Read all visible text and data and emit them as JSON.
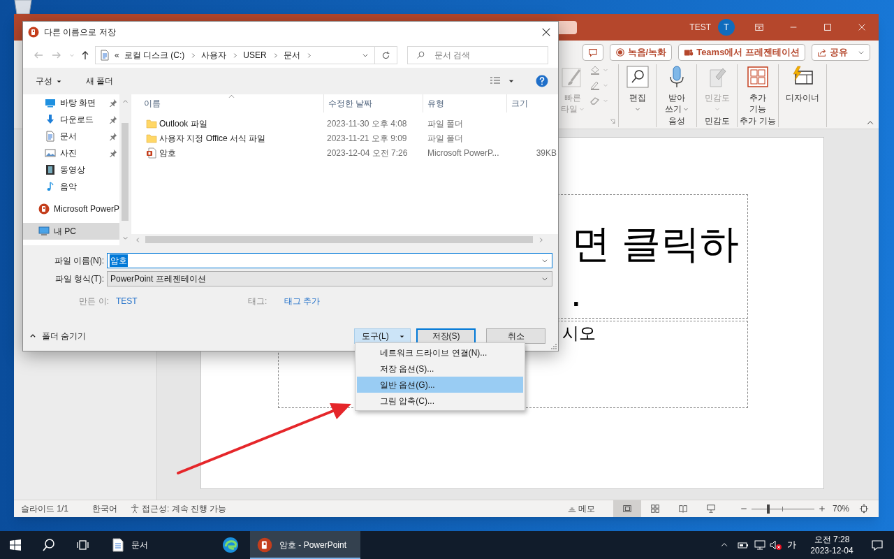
{
  "powerpoint": {
    "title_bar": {
      "user": "TEST",
      "avatar": "T"
    },
    "ribbon_buttons": [
      {
        "kind": "comment"
      },
      {
        "kind": "record",
        "label": "녹음/녹화"
      },
      {
        "kind": "teams",
        "label": "Teams에서 프레젠테이션"
      },
      {
        "kind": "share",
        "label": "공유"
      }
    ],
    "ribbon_groups": [
      {
        "kind": "styles",
        "lines": [
          "빠른",
          "타일"
        ],
        "dropdown": true,
        "disabled": true
      },
      {
        "kind": "edit",
        "lines": [
          "편집"
        ],
        "dropdown": true,
        "disabled": false
      },
      {
        "kind": "dictate",
        "lines": [
          "받아",
          "쓰기"
        ],
        "dropdown": true,
        "disabled": false,
        "group_label": "음성"
      },
      {
        "kind": "sensitivity",
        "lines": [
          "민감도"
        ],
        "dropdown": true,
        "disabled": true,
        "group_label": "민감도"
      },
      {
        "kind": "addins",
        "lines": [
          "추가",
          "기능"
        ],
        "dropdown": false,
        "disabled": false,
        "group_label": "추가 기능"
      },
      {
        "kind": "designer",
        "lines": [
          "디자이너"
        ],
        "dropdown": false,
        "disabled": false
      }
    ],
    "slide": {
      "title": [
        "면 클릭하",
        "."
      ],
      "subtitle": "시오"
    },
    "status_bar": {
      "slide": "슬라이드 1/1",
      "language": "한국어",
      "accessibility": "접근성: 계속 진행 가능",
      "notes": "메모",
      "views": [
        {
          "kind": "normal",
          "selected": true
        },
        {
          "kind": "sorter",
          "selected": false
        },
        {
          "kind": "reading",
          "selected": false
        },
        {
          "kind": "show",
          "selected": false
        }
      ],
      "zoom": {
        "level": 0.27,
        "reading": "70%"
      }
    }
  },
  "dialog": {
    "title": "다른 이름으로 저장",
    "address": {
      "prefix": "«",
      "crumbs": [
        "로컬 디스크 (C:)",
        "사용자",
        "USER",
        "문서"
      ]
    },
    "search": {
      "placeholder": "문서 검색"
    },
    "toolbar": {
      "organize": "구성",
      "new_folder": "새 폴더"
    },
    "nav_items": [
      {
        "kind": "desktop",
        "label": "바탕 화면",
        "pinned": true,
        "selected": false
      },
      {
        "kind": "downloads",
        "label": "다운로드",
        "pinned": true,
        "selected": false
      },
      {
        "kind": "documents",
        "label": "문서",
        "pinned": true,
        "selected": false
      },
      {
        "kind": "pictures",
        "label": "사진",
        "pinned": true,
        "selected": false
      },
      {
        "kind": "videos",
        "label": "동영상",
        "pinned": false,
        "selected": false
      },
      {
        "kind": "music",
        "label": "음악",
        "pinned": false,
        "selected": false
      },
      {
        "kind": "app",
        "label": "Microsoft PowerP",
        "pinned": false,
        "selected": false
      },
      {
        "kind": "pc",
        "label": "내 PC",
        "pinned": false,
        "selected": true
      }
    ],
    "columns": [
      "이름",
      "수정한 날짜",
      "유형",
      "크기"
    ],
    "files": [
      {
        "kind": "folder",
        "name": "Outlook 파일",
        "modified": "2023-11-30 오후 4:08",
        "type": "파일 폴더"
      },
      {
        "kind": "folder",
        "name": "사용자 지정 Office 서식 파일",
        "modified": "2023-11-21 오후 9:09",
        "type": "파일 폴더"
      },
      {
        "kind": "pptx",
        "name": "암호",
        "modified": "2023-12-04 오전 7:26",
        "type": "Microsoft PowerP...",
        "size": "39KB"
      }
    ],
    "file_name": {
      "label": "파일 이름(N):",
      "value": "암호"
    },
    "file_type": {
      "label": "파일 형식(T):",
      "value": "PowerPoint 프레젠테이션"
    },
    "author": {
      "label": "만든 이:",
      "value": "TEST"
    },
    "tags": {
      "label": "태그:",
      "value": "태그 추가"
    },
    "hide_folders": "폴더 숨기기",
    "buttons": [
      {
        "kind": "tools",
        "label": "도구(L)"
      },
      {
        "kind": "save",
        "label": "저장(S)"
      },
      {
        "kind": "cancel",
        "label": "취소"
      }
    ],
    "tools_menu": [
      {
        "label": "네트워크 드라이브 연결(N)...",
        "selected": false
      },
      {
        "label": "저장 옵션(S)...",
        "selected": false
      },
      {
        "label": "일반 옵션(G)...",
        "selected": true
      },
      {
        "label": "그림 압축(C)...",
        "selected": false
      }
    ]
  },
  "taskbar": {
    "apps": [
      {
        "kind": "explorer",
        "label": "문서",
        "active": false
      },
      {
        "kind": "edge",
        "active": false
      },
      {
        "kind": "powerpoint",
        "label": "암호 - PowerPoint",
        "active": true
      }
    ],
    "tray": {
      "ime": "가",
      "time": "오전 7:28",
      "date": "2023-12-04"
    }
  }
}
